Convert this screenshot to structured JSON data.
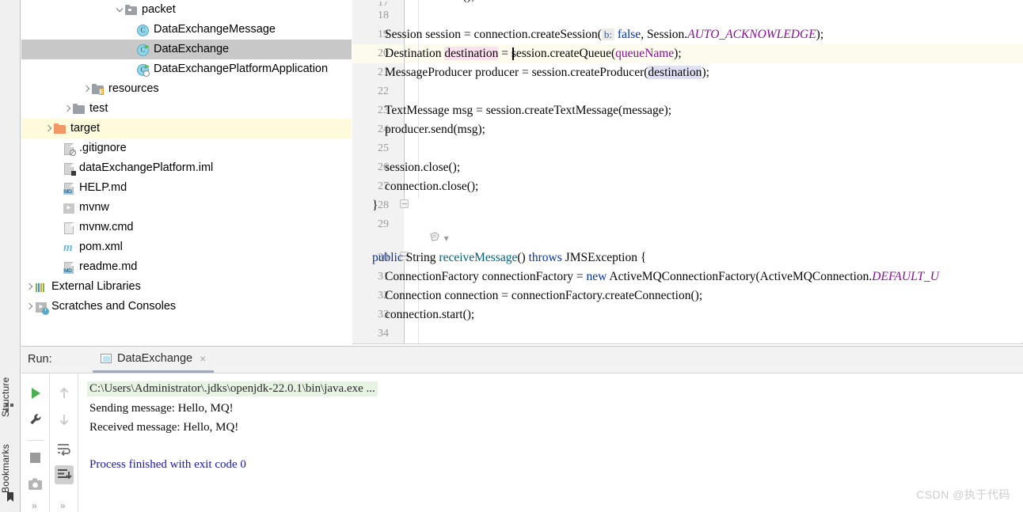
{
  "window": {
    "watermark": "CSDN @执于代码"
  },
  "left_strip": {
    "tabs": [
      {
        "label": "Structure",
        "icon": "structure-icon"
      },
      {
        "label": "Bookmarks",
        "icon": "bookmark-icon"
      }
    ]
  },
  "project_tree": {
    "rows": [
      {
        "label": "packet",
        "icon": "folder-icon",
        "arrow": "down",
        "indent": 118,
        "state": "normal"
      },
      {
        "label": "DataExchangeMessage",
        "icon": "class-icon",
        "arrow": "none",
        "indent": 146,
        "state": "normal"
      },
      {
        "label": "DataExchange",
        "icon": "class-run-icon",
        "arrow": "none",
        "indent": 146,
        "state": "selected"
      },
      {
        "label": "DataExchangePlatformApplication",
        "icon": "class-spring-icon",
        "arrow": "none",
        "indent": 146,
        "state": "normal"
      },
      {
        "label": "resources",
        "icon": "folder-resources-icon",
        "arrow": "right",
        "indent": 76,
        "state": "normal"
      },
      {
        "label": "test",
        "icon": "folder-icon",
        "arrow": "right",
        "indent": 52,
        "state": "normal"
      },
      {
        "label": "target",
        "icon": "folder-orange-icon",
        "arrow": "right",
        "indent": 28,
        "state": "highlight"
      },
      {
        "label": ".gitignore",
        "icon": "gitignore-file-icon",
        "arrow": "none",
        "indent": 52,
        "state": "normal"
      },
      {
        "label": "dataExchangePlatform.iml",
        "icon": "iml-file-icon",
        "arrow": "none",
        "indent": 52,
        "state": "normal"
      },
      {
        "label": "HELP.md",
        "icon": "markdown-file-icon",
        "arrow": "none",
        "indent": 52,
        "state": "normal"
      },
      {
        "label": "mvnw",
        "icon": "shell-script-icon",
        "arrow": "none",
        "indent": 52,
        "state": "normal"
      },
      {
        "label": "mvnw.cmd",
        "icon": "cmd-file-icon",
        "arrow": "none",
        "indent": 52,
        "state": "normal"
      },
      {
        "label": "pom.xml",
        "icon": "maven-file-icon",
        "arrow": "none",
        "indent": 52,
        "state": "normal"
      },
      {
        "label": "readme.md",
        "icon": "markdown-file-icon",
        "arrow": "none",
        "indent": 52,
        "state": "normal"
      },
      {
        "label": "External Libraries",
        "icon": "libraries-icon",
        "arrow": "right",
        "indent": 4,
        "state": "normal"
      },
      {
        "label": "Scratches and Consoles",
        "icon": "scratches-icon",
        "arrow": "right",
        "indent": 4,
        "state": "normal"
      }
    ]
  },
  "editor": {
    "line_numbers": [
      "18",
      "19",
      "20",
      "21",
      "22",
      "23",
      "24",
      "25",
      "26",
      "27",
      "28",
      "29",
      "30",
      "31",
      "32",
      "33",
      "34"
    ],
    "lines": [
      {
        "num": "",
        "text": "connection.start();",
        "partial_top": true
      },
      {
        "num": "18",
        "text": ""
      },
      {
        "num": "19",
        "text": "Session session = connection.createSession( b: false, Session.AUTO_ACKNOWLEDGE);"
      },
      {
        "num": "20",
        "text": "Destination destination = session.createQueue(queueName);",
        "current": true
      },
      {
        "num": "21",
        "text": "MessageProducer producer = session.createProducer(destination);"
      },
      {
        "num": "22",
        "text": ""
      },
      {
        "num": "23",
        "text": "TextMessage msg = session.createTextMessage(message);"
      },
      {
        "num": "24",
        "text": "producer.send(msg);"
      },
      {
        "num": "25",
        "text": ""
      },
      {
        "num": "26",
        "text": "session.close();"
      },
      {
        "num": "27",
        "text": "connection.close();"
      },
      {
        "num": "28",
        "text": "}"
      },
      {
        "num": "29",
        "text": ""
      },
      {
        "num": "30",
        "text": "public String receiveMessage() throws JMSException {"
      },
      {
        "num": "31",
        "text": "ConnectionFactory connectionFactory = new ActiveMQConnectionFactory(ActiveMQConnection.DEFAULT_U"
      },
      {
        "num": "32",
        "text": "Connection connection = connectionFactory.createConnection();"
      },
      {
        "num": "33",
        "text": "connection.start();"
      },
      {
        "num": "34",
        "text": ""
      }
    ],
    "tokens": {
      "l19": {
        "t1": "Session session = connection.createSession(",
        "hint": "b:",
        "kw_false": "false",
        "t2": ", Session.",
        "const": "AUTO_ACKNOWLEDGE",
        "t3": ");"
      },
      "l20": {
        "t1": "Destination ",
        "sel": "destination",
        "t2": " = session.createQueue(",
        "field": "queueName",
        "t3": ");"
      },
      "l21": {
        "t1": "MessageProducer producer = session.createProducer(",
        "sel": "destination",
        "t2": ");"
      },
      "l23": {
        "t1": "TextMessage msg = session.createTextMessage(message);"
      },
      "l24": {
        "t1": "producer.send(msg);"
      },
      "l26": {
        "t1": "session.close();"
      },
      "l27": {
        "t1": "connection.close();"
      },
      "l28": {
        "t1": "}"
      },
      "l30": {
        "kw1": "public",
        "t1": " String ",
        "method": "receiveMessage",
        "t2": "() ",
        "kw2": "throws",
        "t3": " JMSException {"
      },
      "l31": {
        "t1": "ConnectionFactory connectionFactory = ",
        "kw": "new",
        "t2": " ActiveMQConnectionFactory(ActiveMQConnection.",
        "const": "DEFAULT_U"
      },
      "l32": {
        "t1": "Connection connection = connectionFactory.createConnection();"
      },
      "l33": {
        "t1": "connection.start();"
      }
    }
  },
  "run_window": {
    "label": "Run:",
    "tab_title": "DataExchange",
    "close_label": "×",
    "toolbar_left": [
      {
        "name": "rerun-button",
        "icon": "play-icon"
      },
      {
        "name": "settings-button",
        "icon": "wrench-icon"
      },
      {
        "name": "stop-button",
        "icon": "stop-icon"
      },
      {
        "name": "screenshot-button",
        "icon": "camera-icon"
      }
    ],
    "toolbar_right": [
      {
        "name": "prev-occurrence-button",
        "icon": "arrow-up-icon"
      },
      {
        "name": "next-occurrence-button",
        "icon": "arrow-down-icon"
      },
      {
        "name": "soft-wrap-button",
        "icon": "wrap-icon"
      },
      {
        "name": "scroll-to-end-button",
        "icon": "scroll-end-icon"
      }
    ],
    "expand_label": "»",
    "console": [
      {
        "text": "C:\\Users\\Administrator\\.jdks\\openjdk-22.0.1\\bin\\java.exe ...",
        "style": "cmd"
      },
      {
        "text": "Sending message: Hello, MQ!",
        "style": "normal"
      },
      {
        "text": "Received message: Hello, MQ!",
        "style": "normal"
      },
      {
        "text": "Process finished with exit code 0",
        "style": "blue"
      }
    ]
  },
  "colors": {
    "selected_row": "#c8c8c8",
    "highlight_row": "#fdfbdb",
    "current_line": "#fcfbee",
    "keyword": "#0033b3",
    "constant": "#871094",
    "method": "#00627a",
    "console_cmd_bg": "#e6f2e2",
    "exit_text": "#1a1aa8",
    "run_green": "#4caf50"
  }
}
